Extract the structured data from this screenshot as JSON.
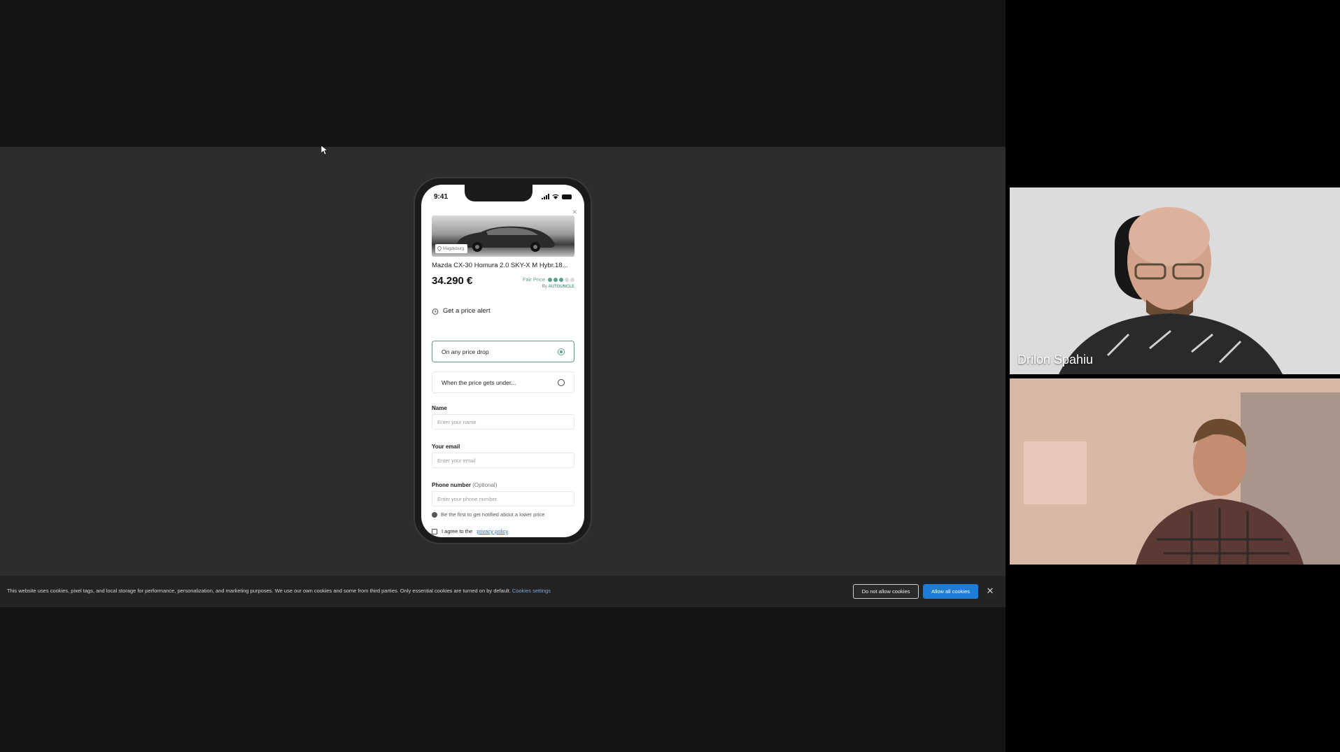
{
  "phone": {
    "status_time": "9:41",
    "location": "Magdeburg",
    "car_title": "Mazda CX-30 Homura 2.0 SKY-X M Hybr.18...",
    "price": "34.290 €",
    "price_rating_label": "Fair Price",
    "price_rating_level": 3,
    "price_rating_max": 5,
    "rated_by_prefix": "By",
    "rated_by_brand": "AUTOUNCLE",
    "alert_heading": "Get a price alert",
    "option_any_drop": "On any price drop",
    "option_under": "When the price gets under...",
    "selected_option": "On any price drop",
    "name_label": "Name",
    "name_placeholder": "Enter your name",
    "email_label": "Your email",
    "email_placeholder": "Enter your email",
    "phone_label": "Phone number",
    "phone_optional": "(Optional)",
    "phone_placeholder": "Enter your phone number",
    "hint": "Be the first to get notified about a lower price",
    "consent_prefix": "I agree to the",
    "consent_link": "privacy policy"
  },
  "cookie_bar": {
    "message": "This website uses cookies, pixel tags, and local storage for performance, personalization, and marketing purposes. We use our own cookies and some from third parties. Only essential cookies are turned on by default.",
    "settings_link": "Cookies settings",
    "deny_label": "Do not allow cookies",
    "allow_label": "Allow all cookies"
  },
  "participants": [
    {
      "name": "Drilon Spahiu"
    },
    {
      "name": ""
    }
  ],
  "colors": {
    "accent_green": "#5b9e8f",
    "link_blue": "#2f6fb5",
    "allow_blue": "#1c7cd6"
  }
}
